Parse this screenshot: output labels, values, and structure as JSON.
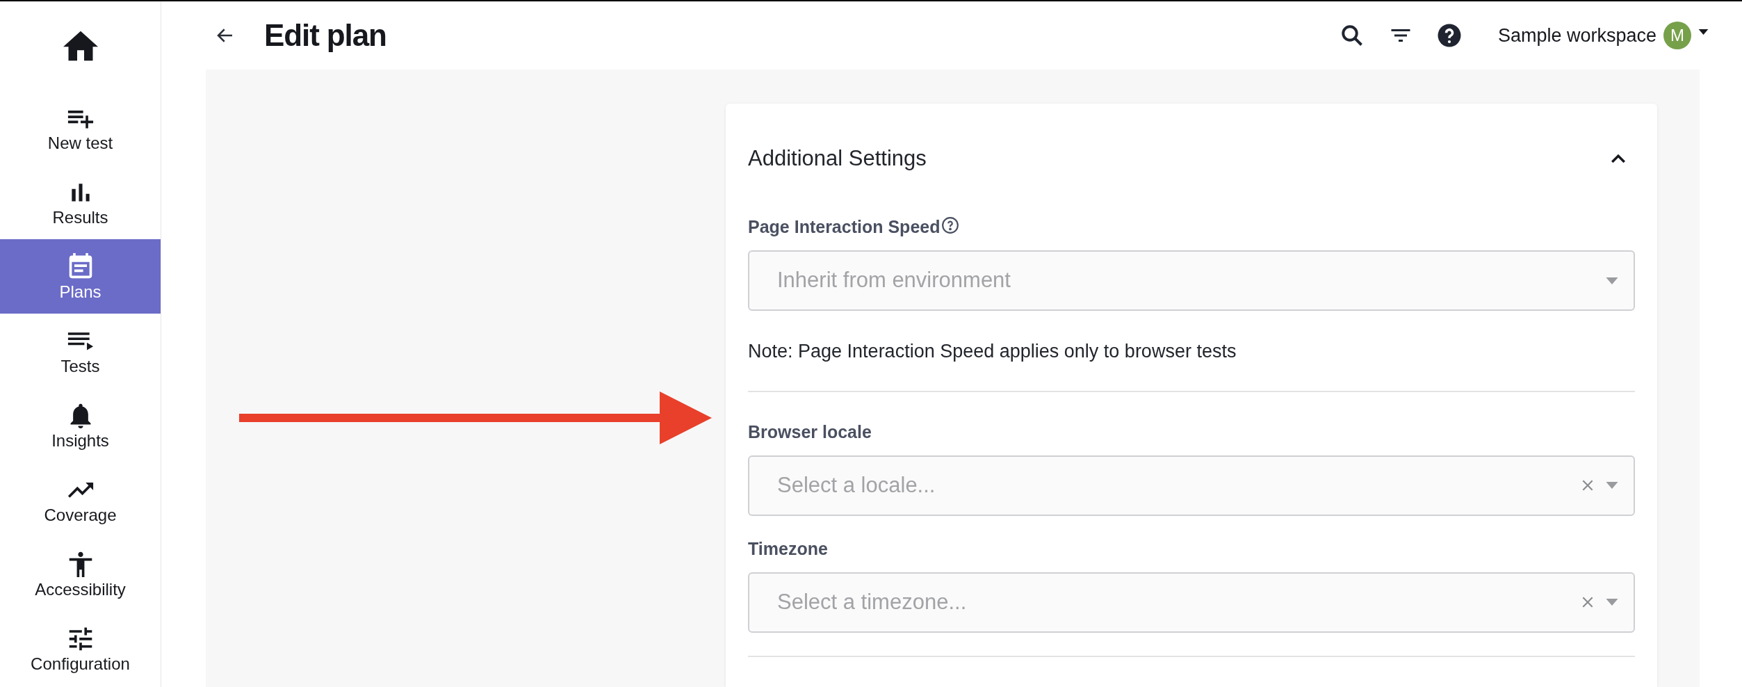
{
  "sidebar": {
    "items": [
      {
        "label": "New test",
        "selected": false
      },
      {
        "label": "Results",
        "selected": false
      },
      {
        "label": "Plans",
        "selected": true
      },
      {
        "label": "Tests",
        "selected": false
      },
      {
        "label": "Insights",
        "selected": false
      },
      {
        "label": "Coverage",
        "selected": false
      },
      {
        "label": "Accessibility",
        "selected": false
      },
      {
        "label": "Configuration",
        "selected": false
      }
    ]
  },
  "header": {
    "title": "Edit plan",
    "workspace": "Sample workspace",
    "avatar": "M"
  },
  "card": {
    "title": "Additional Settings",
    "expanded": true,
    "fields": [
      {
        "label": "Page Interaction Speed",
        "help": true,
        "placeholder": "Inherit from environment",
        "clearable": false,
        "note": "Note: Page Interaction Speed applies only to browser tests"
      },
      {
        "label": "Browser locale",
        "help": false,
        "placeholder": "Select a locale...",
        "clearable": true
      },
      {
        "label": "Timezone",
        "help": false,
        "placeholder": "Select a timezone...",
        "clearable": true
      }
    ]
  }
}
